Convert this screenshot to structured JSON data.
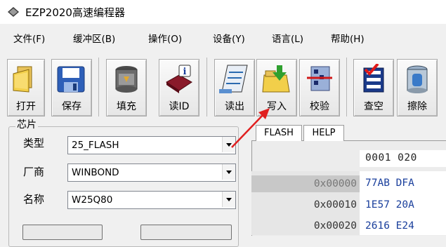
{
  "window": {
    "title": "EZP2020高速编程器",
    "icon": "app-icon"
  },
  "menu": [
    {
      "label": "文件(F)"
    },
    {
      "label": "缓冲区(B)"
    },
    {
      "label": "操作(O)"
    },
    {
      "label": "设备(Y)"
    },
    {
      "label": "语言(L)"
    },
    {
      "label": "帮助(H)"
    }
  ],
  "toolbar": [
    {
      "label": "打开",
      "icon": "open-folder-icon"
    },
    {
      "label": "保存",
      "icon": "floppy-disk-icon"
    },
    {
      "label": "填充",
      "icon": "fill-bucket-icon"
    },
    {
      "label": "读ID",
      "icon": "chip-info-icon"
    },
    {
      "label": "读出",
      "icon": "read-notepad-icon"
    },
    {
      "label": "写入",
      "icon": "write-folder-icon"
    },
    {
      "label": "校验",
      "icon": "verify-icon"
    },
    {
      "label": "查空",
      "icon": "blank-check-icon"
    },
    {
      "label": "擦除",
      "icon": "erase-can-icon"
    }
  ],
  "chip": {
    "group_title": "芯片",
    "type_label": "类型",
    "type_value": "25_FLASH",
    "vendor_label": "厂商",
    "vendor_value": "WINBOND",
    "name_label": "名称",
    "name_value": "W25Q80"
  },
  "tabs": [
    {
      "label": "FLASH",
      "active": true
    },
    {
      "label": "HELP",
      "active": false
    }
  ],
  "hex": {
    "header": "0001 020",
    "rows": [
      {
        "address": "0x00000",
        "data": "77AB DFA",
        "selected": true
      },
      {
        "address": "0x00010",
        "data": "1E57 20A",
        "selected": false
      },
      {
        "address": "0x00020",
        "data": "2616 E24",
        "selected": false
      }
    ]
  },
  "colors": {
    "annotation_arrow": "#e02020",
    "hex_data": "#1a3f9c"
  }
}
